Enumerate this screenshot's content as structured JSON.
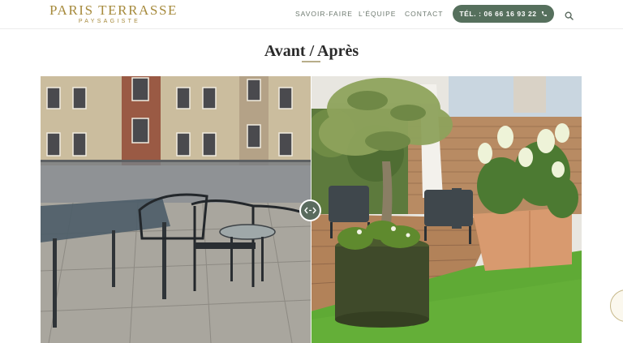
{
  "header": {
    "logo": {
      "title": "PARIS TERRASSE",
      "subtitle": "PAYSAGISTE"
    },
    "nav": [
      {
        "label": "SAVOIR-FAIRE"
      },
      {
        "label": "L'ÉQUIPE"
      },
      {
        "label": "CONTACT"
      }
    ],
    "phone_button": {
      "label": "TÉL. : 06 66 16 93 22",
      "icon": "phone-icon"
    },
    "search_icon": "search-icon"
  },
  "section": {
    "title": "Avant / Après"
  },
  "comparison": {
    "handle_icon": "arrows-left-right-icon",
    "images": [
      "before-terrace-photo",
      "after-terrace-photo"
    ]
  },
  "colors": {
    "brand_gold": "#a68a3c",
    "nav_text": "#6e7a70",
    "button_green": "#56705d",
    "handle_green": "#5a6b5e"
  }
}
